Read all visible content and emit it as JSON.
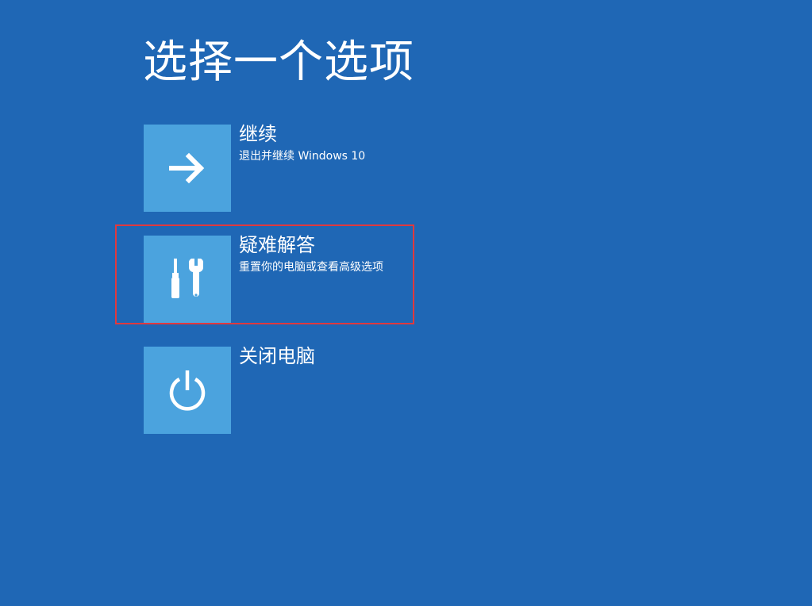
{
  "page": {
    "title": "选择一个选项"
  },
  "options": [
    {
      "id": "continue",
      "icon": "arrow-right-icon",
      "label": "继续",
      "description": "退出并继续 Windows 10"
    },
    {
      "id": "troubleshoot",
      "icon": "tools-icon",
      "label": "疑难解答",
      "description": "重置你的电脑或查看高级选项",
      "highlighted": true
    },
    {
      "id": "shutdown",
      "icon": "power-icon",
      "label": "关闭电脑",
      "description": ""
    }
  ],
  "colors": {
    "background": "#1f67b5",
    "tile": "#4ba3de",
    "text": "#ffffff",
    "highlight_border": "#e0393e"
  }
}
